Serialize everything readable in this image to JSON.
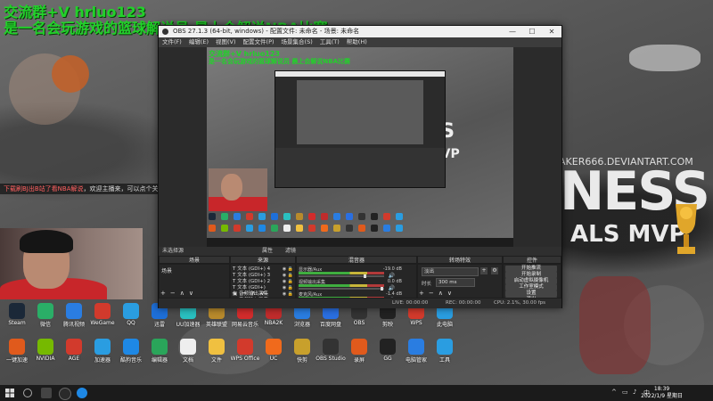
{
  "overlay": {
    "line1": "交流群+V hrluo123",
    "line2": "是一名会玩游戏的篮球解说员 晨上会解说NBA比赛"
  },
  "wallpaper": {
    "watermark": "AKER666.DEVIANTART.COM",
    "big_title": "NESS",
    "subtitle": "ALS MVP"
  },
  "chat_bar": {
    "highlight": "下载刷BJ出B站了看NBA解说",
    "message": "，欢迎主播来，可以点个关注"
  },
  "obs": {
    "title": "OBS 27.1.3 (64-bit, windows) - 配置文件: 未命名 - 场景: 未命名",
    "window_controls": {
      "minimize": "—",
      "maximize": "☐",
      "close": "✕"
    },
    "menu": [
      "文件(F)",
      "编辑(E)",
      "视图(V)",
      "配置文件(P)",
      "场景集合(S)",
      "工具(T)",
      "帮助(H)"
    ],
    "preview_overlay1": "交流群+V hrluo123",
    "preview_overlay2": "是一名会玩游戏的篮球解说员 晨上会解说NBA比赛",
    "preview_ness": "NESS",
    "preview_mvp": "ALS MVP",
    "dockbar": {
      "label": "未选择源",
      "props": "属性",
      "filters": "滤镜"
    },
    "docks": {
      "scenes": {
        "header": "场景",
        "items": [
          "场景"
        ]
      },
      "sources": {
        "header": "来源",
        "items": [
          {
            "type": "T",
            "name": "文本 (GDI+) 4"
          },
          {
            "type": "T",
            "name": "文本 (GDI+) 3"
          },
          {
            "type": "T",
            "name": "文本 (GDI+) 2"
          },
          {
            "type": "T",
            "name": "文本 (GDI+)"
          },
          {
            "type": "▣",
            "name": "音频输出采集"
          },
          {
            "type": "▣",
            "name": "音频输入采集"
          }
        ]
      },
      "mixer": {
        "header": "混音器",
        "rows": [
          {
            "name": "显示器/Aux",
            "db": "-19.0 dB",
            "level": 0.78
          },
          {
            "name": "视频输出采集",
            "db": "0.0 dB",
            "level": 0.99
          },
          {
            "name": "麦克风/Aux",
            "db": "-1.4 dB",
            "level": 0.55
          }
        ]
      },
      "transitions": {
        "header": "转场特效",
        "type": "淡出",
        "duration_label": "时长",
        "duration": "300 ms"
      },
      "controls": {
        "header": "控件",
        "buttons": [
          "开始推流",
          "开始录制",
          "启动虚拟摄像机",
          "工作室模式",
          "设置",
          "退出"
        ]
      }
    },
    "status": {
      "live": "LIVE: 00:00:00",
      "rec": "REC: 00:00:00",
      "cpu": "CPU: 2.1%, 30.00 fps"
    },
    "footer_symbols": [
      "+",
      "−",
      "∧",
      "∨"
    ]
  },
  "desktop_icons": [
    {
      "label": "Steam",
      "color": "#1b2838"
    },
    {
      "label": "微信",
      "color": "#2aae67"
    },
    {
      "label": "腾讯视频",
      "color": "#2a7de1"
    },
    {
      "label": "WeGame",
      "color": "#d23a2c"
    },
    {
      "label": "QQ",
      "color": "#2a9de1"
    },
    {
      "label": "迅雷",
      "color": "#1e6fd8"
    },
    {
      "label": "UU加速器",
      "color": "#2ac0c0"
    },
    {
      "label": "英雄联盟",
      "color": "#b88a2c"
    },
    {
      "label": "网易云音乐",
      "color": "#d22c2c"
    },
    {
      "label": "NBA2K",
      "color": "#c02c2c"
    },
    {
      "label": "浏览器",
      "color": "#2a7de1"
    },
    {
      "label": "百度网盘",
      "color": "#2a6fe1"
    },
    {
      "label": "OBS",
      "color": "#333333"
    },
    {
      "label": "剪映",
      "color": "#222222"
    },
    {
      "label": "WPS",
      "color": "#d23a2c"
    },
    {
      "label": "此电脑",
      "color": "#2a9de1"
    }
  ],
  "desktop_icons_row2": [
    {
      "label": "一键加速",
      "color": "#e05a1c"
    },
    {
      "label": "NVIDIA",
      "color": "#76b900"
    },
    {
      "label": "AGE",
      "color": "#d23a2c"
    },
    {
      "label": "加速器",
      "color": "#2a9de1"
    },
    {
      "label": "酷狗音乐",
      "color": "#1e88e5"
    },
    {
      "label": "编辑器",
      "color": "#2aa55a"
    },
    {
      "label": "文档",
      "color": "#eeeeee"
    },
    {
      "label": "文件",
      "color": "#f0c040"
    },
    {
      "label": "WPS Office",
      "color": "#d23a2c"
    },
    {
      "label": "UC",
      "color": "#f06a1c"
    },
    {
      "label": "快剪",
      "color": "#c8a02c"
    },
    {
      "label": "OBS Studio",
      "color": "#333333"
    },
    {
      "label": "录屏",
      "color": "#e05a1c"
    },
    {
      "label": "GG",
      "color": "#222222"
    },
    {
      "label": "电脑管家",
      "color": "#2a7de1"
    },
    {
      "label": "工具",
      "color": "#2a9de1"
    }
  ],
  "taskbar": {
    "time": "18:39",
    "date": "2022/1/9 星期日",
    "tray": [
      "^",
      "▭",
      "♪",
      "中"
    ]
  },
  "colors": {
    "overlay_green": "#22d12a",
    "obs_dark": "#2b2b2b",
    "taskbar": "#1b1b1b"
  }
}
